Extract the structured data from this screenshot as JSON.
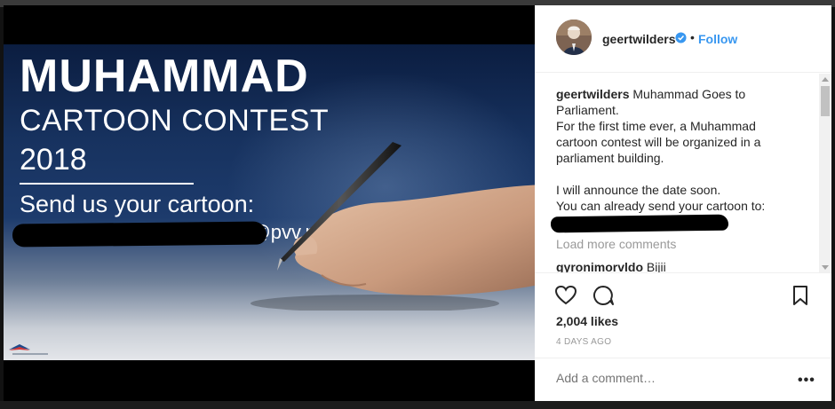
{
  "poster": {
    "title": "MUHAMMAD",
    "subtitle": "CARTOON CONTEST",
    "year": "2018",
    "send_text": "Send us your cartoon:",
    "email_partial": "muhammadcartooncontest@pvv.nl",
    "logo_text": "PARTY FOR FREEDOM"
  },
  "header": {
    "username": "geertwilders",
    "separator": "•",
    "follow_label": "Follow"
  },
  "caption": {
    "username": "geertwilders",
    "text": "Muhammad Goes to Parliament.\nFor the first time ever, a Muhammad cartoon contest will be organized in a parliament building.\n\nI will announce the date soon.\nYou can already send your cartoon to:"
  },
  "load_more": "Load more comments",
  "comment": {
    "username": "gyronimorvldo",
    "text": "Bijii"
  },
  "likes": "2,004 likes",
  "date": "4 DAYS AGO",
  "add_comment_placeholder": "Add a comment…",
  "more_label": "•••",
  "colors": {
    "link": "#3897f0",
    "text": "#262626",
    "muted": "#999999"
  },
  "icons": [
    "heart-icon",
    "comment-icon",
    "bookmark-icon",
    "verified-icon",
    "more-icon"
  ]
}
